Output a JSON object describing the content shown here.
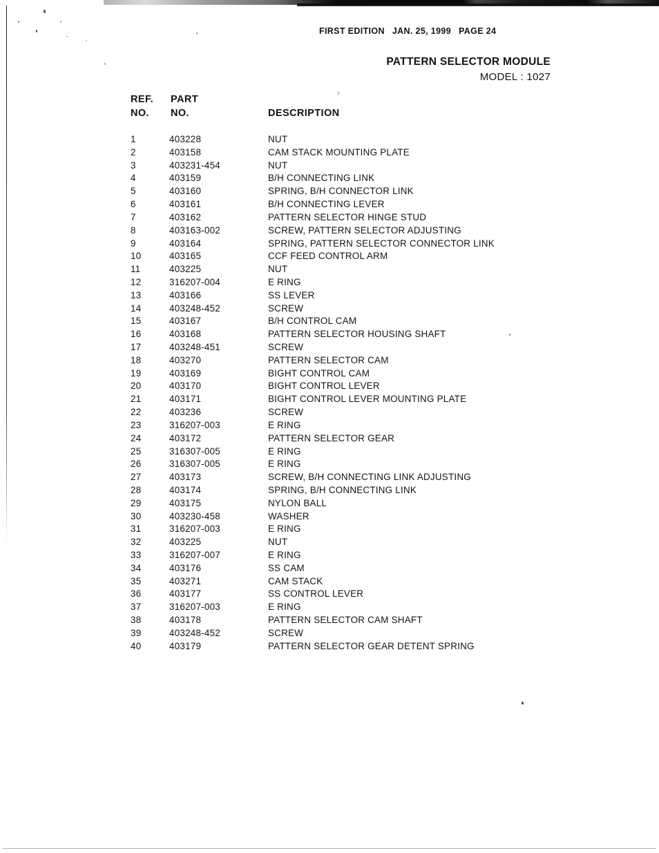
{
  "header": {
    "edition": "FIRST EDITION",
    "date": "JAN. 25, 1999",
    "page": "PAGE 24",
    "title": "PATTERN SELECTOR MODULE",
    "model": "MODEL : 1027"
  },
  "columns": {
    "ref_line1": "REF.",
    "ref_line2": "NO.",
    "part_line1": "PART",
    "part_line2": "NO.",
    "description": "DESCRIPTION"
  },
  "parts": [
    {
      "ref": "1",
      "part": "403228",
      "desc": "NUT"
    },
    {
      "ref": "2",
      "part": "403158",
      "desc": "CAM STACK MOUNTING PLATE"
    },
    {
      "ref": "3",
      "part": "403231-454",
      "desc": "NUT"
    },
    {
      "ref": "4",
      "part": "403159",
      "desc": "B/H CONNECTING LINK"
    },
    {
      "ref": "5",
      "part": "403160",
      "desc": "SPRING, B/H CONNECTOR LINK"
    },
    {
      "ref": "6",
      "part": "403161",
      "desc": "B/H CONNECTING LEVER"
    },
    {
      "ref": "7",
      "part": "403162",
      "desc": "PATTERN SELECTOR HINGE STUD"
    },
    {
      "ref": "8",
      "part": "403163-002",
      "desc": "SCREW, PATTERN SELECTOR ADJUSTING"
    },
    {
      "ref": "9",
      "part": "403164",
      "desc": "SPRING, PATTERN SELECTOR CONNECTOR LINK"
    },
    {
      "ref": "10",
      "part": "403165",
      "desc": "CCF FEED CONTROL ARM"
    },
    {
      "ref": "11",
      "part": "403225",
      "desc": "NUT"
    },
    {
      "ref": "12",
      "part": "316207-004",
      "desc": "E RING"
    },
    {
      "ref": "13",
      "part": "403166",
      "desc": "SS LEVER"
    },
    {
      "ref": "14",
      "part": "403248-452",
      "desc": "SCREW"
    },
    {
      "ref": "15",
      "part": "403167",
      "desc": "B/H CONTROL CAM"
    },
    {
      "ref": "16",
      "part": "403168",
      "desc": "PATTERN SELECTOR HOUSING SHAFT"
    },
    {
      "ref": "17",
      "part": "403248-451",
      "desc": "SCREW"
    },
    {
      "ref": "18",
      "part": "403270",
      "desc": "PATTERN SELECTOR CAM"
    },
    {
      "ref": "19",
      "part": "403169",
      "desc": "BIGHT CONTROL CAM"
    },
    {
      "ref": "20",
      "part": "403170",
      "desc": "BIGHT CONTROL LEVER"
    },
    {
      "ref": "21",
      "part": "403171",
      "desc": "BIGHT CONTROL LEVER MOUNTING PLATE"
    },
    {
      "ref": "22",
      "part": "403236",
      "desc": "SCREW"
    },
    {
      "ref": "23",
      "part": "316207-003",
      "desc": "E RING"
    },
    {
      "ref": "24",
      "part": "403172",
      "desc": "PATTERN SELECTOR GEAR"
    },
    {
      "ref": "25",
      "part": "316307-005",
      "desc": "E RING"
    },
    {
      "ref": "26",
      "part": "316307-005",
      "desc": "E RING"
    },
    {
      "ref": "27",
      "part": "403173",
      "desc": "SCREW, B/H CONNECTING LINK ADJUSTING"
    },
    {
      "ref": "28",
      "part": "403174",
      "desc": "SPRING, B/H CONNECTING LINK"
    },
    {
      "ref": "29",
      "part": "403175",
      "desc": "NYLON BALL"
    },
    {
      "ref": "30",
      "part": "403230-458",
      "desc": "WASHER"
    },
    {
      "ref": "31",
      "part": "316207-003",
      "desc": "E RING"
    },
    {
      "ref": "32",
      "part": "403225",
      "desc": "NUT"
    },
    {
      "ref": "33",
      "part": "316207-007",
      "desc": "E RING"
    },
    {
      "ref": "34",
      "part": "403176",
      "desc": "SS CAM"
    },
    {
      "ref": "35",
      "part": "403271",
      "desc": "CAM STACK"
    },
    {
      "ref": "36",
      "part": "403177",
      "desc": "SS CONTROL LEVER"
    },
    {
      "ref": "37",
      "part": "316207-003",
      "desc": "E RING"
    },
    {
      "ref": "38",
      "part": "403178",
      "desc": "PATTERN SELECTOR CAM SHAFT"
    },
    {
      "ref": "39",
      "part": "403248-452",
      "desc": "SCREW"
    },
    {
      "ref": "40",
      "part": "403179",
      "desc": "PATTERN SELECTOR GEAR DETENT SPRING"
    }
  ]
}
